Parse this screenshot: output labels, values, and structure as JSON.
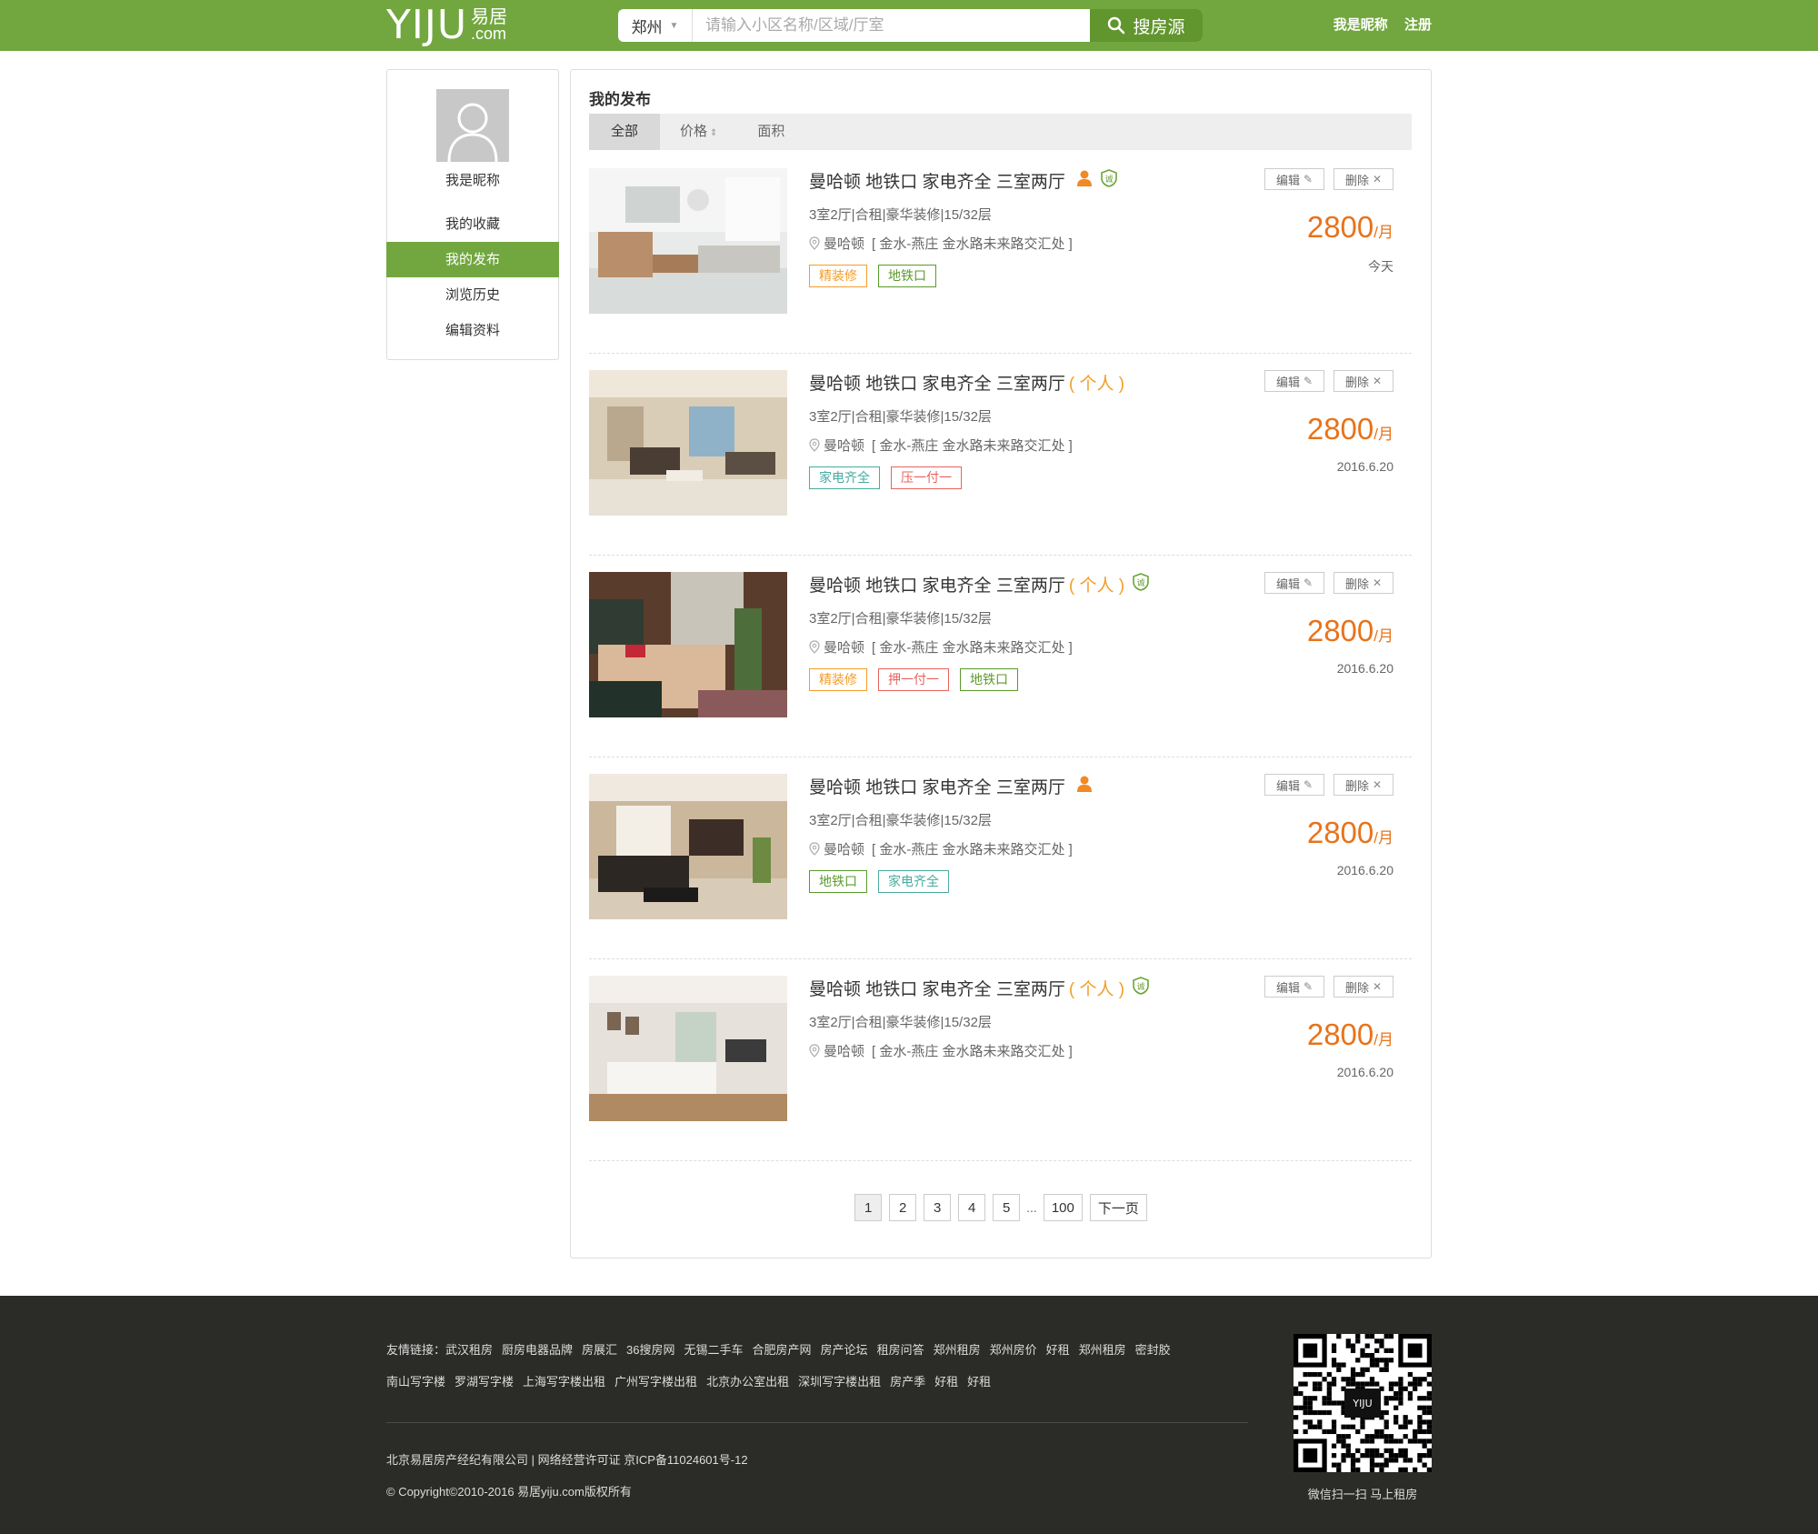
{
  "header": {
    "logo_main": "YIJU",
    "logo_cn": "易居",
    "logo_en": ".com",
    "city": "郑州",
    "search_placeholder": "请输入小区名称/区域/厅室",
    "search_button": "搜房源",
    "nickname_link": "我是昵称",
    "register_link": "注册"
  },
  "sidebar": {
    "nickname": "我是昵称",
    "items": [
      {
        "label": "我的收藏",
        "active": false
      },
      {
        "label": "我的发布",
        "active": true
      },
      {
        "label": "浏览历史",
        "active": false
      },
      {
        "label": "编辑资料",
        "active": false
      }
    ]
  },
  "main": {
    "title": "我的发布",
    "tabs": [
      {
        "label": "全部",
        "active": true
      },
      {
        "label": "价格",
        "active": false
      },
      {
        "label": "面积",
        "active": false
      }
    ],
    "edit_label": "编辑",
    "delete_label": "删除",
    "listings": [
      {
        "title": "曼哈顿 地铁口 家电齐全 三室两厅",
        "personal": "",
        "info": "3室2厅|合租|豪华装修|15/32层",
        "area": "曼哈顿",
        "address": "[ 金水-燕庄 金水路未来路交汇处 ]",
        "tags": [
          {
            "text": "精装修",
            "color": "orange"
          },
          {
            "text": "地铁口",
            "color": "green"
          }
        ],
        "price": "2800",
        "unit": "/月",
        "date": "今天"
      },
      {
        "title": "曼哈顿 地铁口 家电齐全 三室两厅",
        "personal": "( 个人 )",
        "info": "3室2厅|合租|豪华装修|15/32层",
        "area": "曼哈顿",
        "address": "[ 金水-燕庄 金水路未来路交汇处 ]",
        "tags": [
          {
            "text": "家电齐全",
            "color": "teal"
          },
          {
            "text": "压一付一",
            "color": "red"
          }
        ],
        "price": "2800",
        "unit": "/月",
        "date": "2016.6.20"
      },
      {
        "title": "曼哈顿 地铁口 家电齐全 三室两厅",
        "personal": "( 个人 )",
        "info": "3室2厅|合租|豪华装修|15/32层",
        "area": "曼哈顿",
        "address": "[ 金水-燕庄 金水路未来路交汇处 ]",
        "tags": [
          {
            "text": "精装修",
            "color": "orange"
          },
          {
            "text": "押一付一",
            "color": "red"
          },
          {
            "text": "地铁口",
            "color": "green"
          }
        ],
        "price": "2800",
        "unit": "/月",
        "date": "2016.6.20"
      },
      {
        "title": "曼哈顿 地铁口 家电齐全 三室两厅",
        "personal": "",
        "info": "3室2厅|合租|豪华装修|15/32层",
        "area": "曼哈顿",
        "address": "[ 金水-燕庄 金水路未来路交汇处 ]",
        "tags": [
          {
            "text": "地铁口",
            "color": "green"
          },
          {
            "text": "家电齐全",
            "color": "teal"
          }
        ],
        "price": "2800",
        "unit": "/月",
        "date": "2016.6.20"
      },
      {
        "title": "曼哈顿 地铁口 家电齐全 三室两厅",
        "personal": "( 个人 )",
        "info": "3室2厅|合租|豪华装修|15/32层",
        "area": "曼哈顿",
        "address": "[ 金水-燕庄 金水路未来路交汇处 ]",
        "tags": [],
        "price": "2800",
        "unit": "/月",
        "date": "2016.6.20"
      }
    ],
    "pagination": [
      "1",
      "2",
      "3",
      "4",
      "5",
      "...",
      "100",
      "下一页"
    ]
  },
  "footer": {
    "links_row1": [
      "友情链接：武汉租房",
      "厨房电器品牌",
      "房展汇",
      "36搜房网",
      "无锡二手车",
      "合肥房产网",
      "房产论坛",
      "租房问答",
      "郑州租房",
      "郑州房价",
      "好租",
      "郑州租房",
      "密封胶"
    ],
    "links_row2": [
      "南山写字楼",
      "罗湖写字楼",
      "上海写字楼出租",
      "广州写字楼出租",
      "北京办公室出租",
      "深圳写字楼出租",
      "房产季",
      "好租",
      "好租"
    ],
    "company": "北京易居房产经纪有限公司 | 网络经营许可证 京ICP备11024601号-12",
    "copyright": "© Copyright©2010-2016 易居yiju.com版权所有",
    "qr_caption": "微信扫一扫  马上租房"
  },
  "colors": {
    "brand_green": "#72a73f",
    "price_orange": "#e8731a",
    "footer_bg": "#2b2b28"
  }
}
